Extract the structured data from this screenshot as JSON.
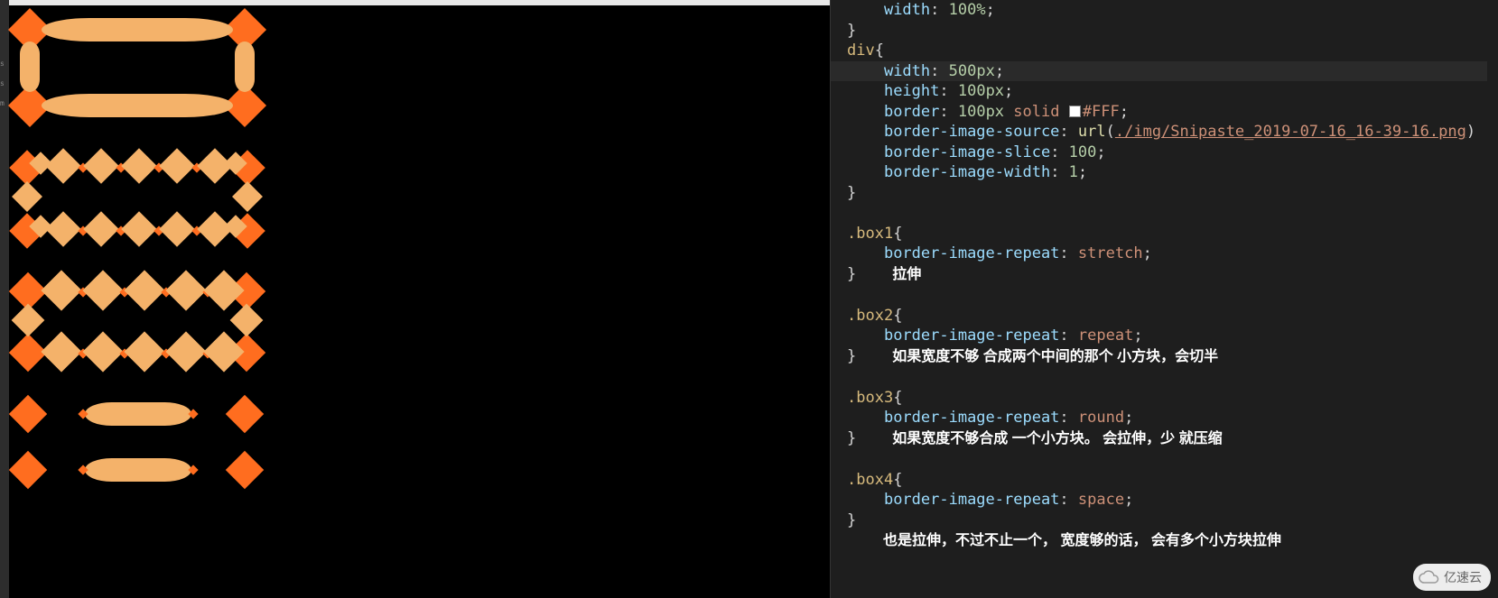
{
  "code": {
    "prev_rule": {
      "prop": "width",
      "value": "100%"
    },
    "div_selector": "div",
    "div_rules": [
      {
        "prop": "width",
        "value": "500px"
      },
      {
        "prop": "height",
        "value": "100px"
      },
      {
        "prop": "border",
        "value_size": "100px",
        "value_style": "solid",
        "value_color": "#FFF"
      },
      {
        "prop": "border-image-source",
        "func": "url",
        "path": "./img/Snipaste_2019-07-16_16-39-16.png"
      },
      {
        "prop": "border-image-slice",
        "value": "100"
      },
      {
        "prop": "border-image-width",
        "value": "1"
      }
    ],
    "boxes": [
      {
        "selector": ".box1",
        "prop": "border-image-repeat",
        "value": "stretch",
        "annotation": "拉伸"
      },
      {
        "selector": ".box2",
        "prop": "border-image-repeat",
        "value": "repeat",
        "annotation": "如果宽度不够 合成两个中间的那个 小方块，会切半"
      },
      {
        "selector": ".box3",
        "prop": "border-image-repeat",
        "value": "round",
        "annotation": "如果宽度不够合成 一个小方块。 会拉伸，少 就压缩"
      },
      {
        "selector": ".box4",
        "prop": "border-image-repeat",
        "value": "space",
        "annotation": "也是拉伸，不过不止一个， 宽度够的话， 会有多个小方块拉伸"
      }
    ]
  },
  "preview": {
    "boxes": [
      "stretch",
      "repeat",
      "round",
      "space"
    ]
  },
  "watermark": "亿速云",
  "sidebar_letters": [
    "s",
    "s",
    "m"
  ]
}
